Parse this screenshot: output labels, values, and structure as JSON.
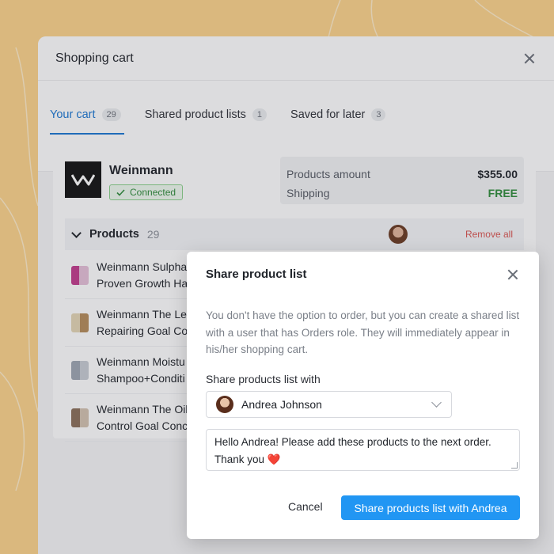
{
  "cart": {
    "title": "Shopping cart",
    "tabs": [
      {
        "label": "Your cart",
        "count": "29"
      },
      {
        "label": "Shared product lists",
        "count": "1"
      },
      {
        "label": "Saved for later",
        "count": "3"
      }
    ],
    "vendor": {
      "name": "Weinmann",
      "status": "Connected",
      "logo_text": "W"
    },
    "summary": {
      "products_amount_label": "Products amount",
      "products_amount_value": "$355.00",
      "shipping_label": "Shipping",
      "shipping_value": "FREE"
    },
    "products_header": {
      "label": "Products",
      "count": "29",
      "remove_all": "Remove all"
    },
    "products": [
      {
        "line1": "Weinmann Sulpha",
        "line2": "Proven Growth Ha"
      },
      {
        "line1": "Weinmann The Le",
        "line2": "Repairing Goal Co"
      },
      {
        "line1": "Weinmann Moistu",
        "line2": "Shampoo+Conditi"
      },
      {
        "line1": "Weinmann The Oil",
        "line2": "Control Goal Conc"
      }
    ]
  },
  "modal": {
    "title": "Share product list",
    "description": "You don't have the option to order, but you can create a shared list with a user that has Orders role. They will immediately appear in his/her shopping cart.",
    "share_label": "Share products list with",
    "selected_user": "Andrea Johnson",
    "message_line1": "Hello Andrea! Please add these products to the next order.",
    "message_line2": "Thank you",
    "message_emoji": "❤️",
    "cancel_label": "Cancel",
    "submit_label": "Share products list with Andrea"
  },
  "colors": {
    "background": "#fdd38a",
    "accent": "#2196f3",
    "active_tab": "#1976d2",
    "success": "#2e8b3a",
    "danger": "#d9534f"
  }
}
